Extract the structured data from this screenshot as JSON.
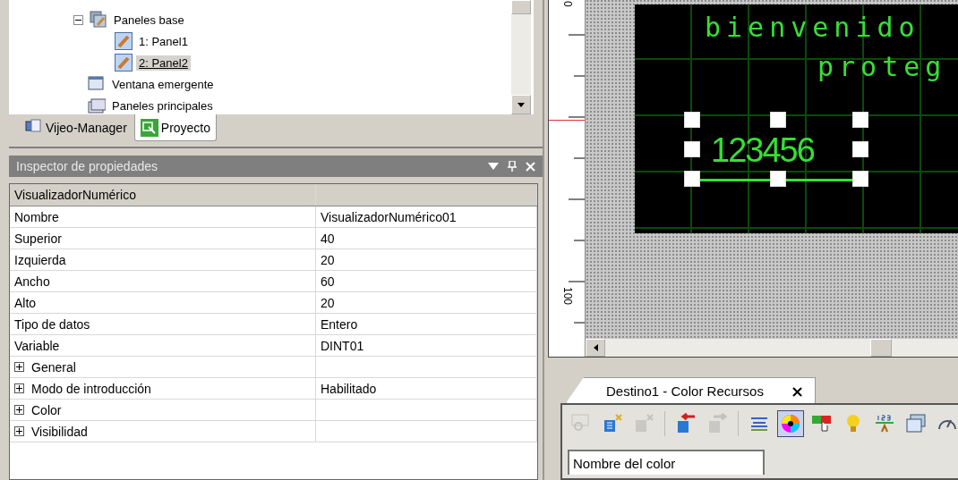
{
  "project_tree": {
    "items": [
      {
        "label": "Paneles base",
        "expanded": true,
        "selected": false,
        "children": [
          {
            "label": "1: Panel1",
            "selected": false
          },
          {
            "label": "2: Panel2",
            "selected": true
          }
        ]
      },
      {
        "label": "Ventana emergente",
        "selected": false
      },
      {
        "label": "Paneles principales",
        "selected": false
      }
    ]
  },
  "navigator_tabs": [
    {
      "label": "Vijeo-Manager",
      "selected": false
    },
    {
      "label": "Proyecto",
      "selected": true
    }
  ],
  "property_inspector": {
    "title": "Inspector de propiedades",
    "object_type": "VisualizadorNumérico",
    "rows": [
      {
        "kind": "plain",
        "name": "Nombre",
        "value": "VisualizadorNumérico01"
      },
      {
        "kind": "plain",
        "name": "Superior",
        "value": "40"
      },
      {
        "kind": "plain",
        "name": "Izquierda",
        "value": "20"
      },
      {
        "kind": "plain",
        "name": "Ancho",
        "value": "60"
      },
      {
        "kind": "plain",
        "name": "Alto",
        "value": "20"
      },
      {
        "kind": "plain",
        "name": "Tipo de datos",
        "value": "Entero"
      },
      {
        "kind": "plain",
        "name": "Variable",
        "value": "DINT01"
      },
      {
        "kind": "group",
        "name": "General",
        "value": "",
        "expanded": false
      },
      {
        "kind": "group",
        "name": "Modo de introducción",
        "value": "Habilitado",
        "expanded": false
      },
      {
        "kind": "group",
        "name": "Color",
        "value": "",
        "expanded": false
      },
      {
        "kind": "group",
        "name": "Visibilidad",
        "value": "",
        "expanded": false
      }
    ]
  },
  "designer": {
    "ruler_labels": [
      "0",
      "100"
    ],
    "screen_texts": [
      "bienvenido",
      "proteg"
    ],
    "numeric_display": {
      "value": "123456",
      "selected": true
    }
  },
  "resource_panel": {
    "tab": {
      "label": "Destino1 - Color Recursos",
      "close": "×"
    },
    "toolbar": [
      {
        "kind": "button",
        "disabled": true,
        "selected": false
      },
      {
        "kind": "button",
        "disabled": false,
        "selected": false
      },
      {
        "kind": "button",
        "disabled": true,
        "selected": false
      },
      {
        "kind": "separator"
      },
      {
        "kind": "button",
        "disabled": false,
        "selected": false
      },
      {
        "kind": "button",
        "disabled": true,
        "selected": false
      },
      {
        "kind": "separator"
      },
      {
        "kind": "button",
        "disabled": false,
        "selected": false
      },
      {
        "kind": "button",
        "disabled": false,
        "selected": true
      },
      {
        "kind": "button",
        "disabled": false,
        "selected": false
      },
      {
        "kind": "button",
        "disabled": false,
        "selected": false
      },
      {
        "kind": "button",
        "disabled": false,
        "selected": false
      },
      {
        "kind": "button",
        "disabled": false,
        "selected": false
      },
      {
        "kind": "button",
        "disabled": false,
        "selected": false
      }
    ],
    "column_header": "Nombre del color"
  }
}
